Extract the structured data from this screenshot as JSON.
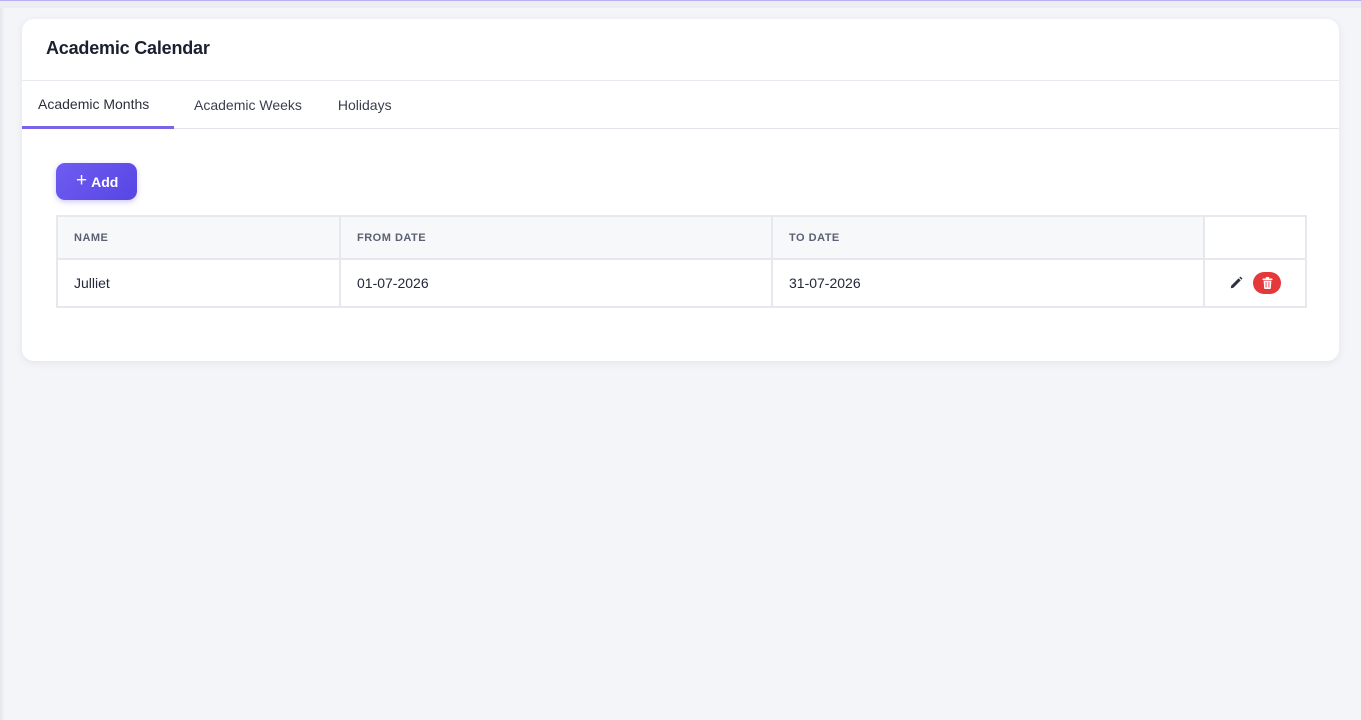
{
  "page": {
    "title": "Academic Calendar"
  },
  "tabs": [
    {
      "label": "Academic Months",
      "active": true
    },
    {
      "label": "Academic Weeks",
      "active": false
    },
    {
      "label": "Holidays",
      "active": false
    }
  ],
  "toolbar": {
    "add_label": "Add",
    "add_icon": "plus-icon"
  },
  "table": {
    "columns": [
      "NAME",
      "FROM DATE",
      "TO DATE",
      ""
    ],
    "rows": [
      {
        "name": "Julliet",
        "from_date": "01-07-2026",
        "to_date": "31-07-2026",
        "actions": [
          "edit-icon",
          "trash-icon"
        ]
      }
    ]
  },
  "colors": {
    "accent": "#6a57ec",
    "danger": "#e5383b",
    "background": "#f4f5f9"
  }
}
